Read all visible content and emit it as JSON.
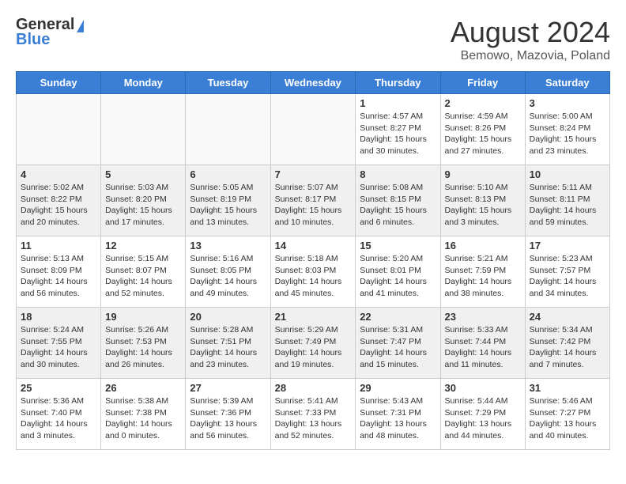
{
  "logo": {
    "text_general": "General",
    "text_blue": "Blue"
  },
  "title": "August 2024",
  "subtitle": "Bemowo, Mazovia, Poland",
  "weekdays": [
    "Sunday",
    "Monday",
    "Tuesday",
    "Wednesday",
    "Thursday",
    "Friday",
    "Saturday"
  ],
  "weeks": [
    [
      {
        "day": "",
        "info": ""
      },
      {
        "day": "",
        "info": ""
      },
      {
        "day": "",
        "info": ""
      },
      {
        "day": "",
        "info": ""
      },
      {
        "day": "1",
        "info": "Sunrise: 4:57 AM\nSunset: 8:27 PM\nDaylight: 15 hours\nand 30 minutes."
      },
      {
        "day": "2",
        "info": "Sunrise: 4:59 AM\nSunset: 8:26 PM\nDaylight: 15 hours\nand 27 minutes."
      },
      {
        "day": "3",
        "info": "Sunrise: 5:00 AM\nSunset: 8:24 PM\nDaylight: 15 hours\nand 23 minutes."
      }
    ],
    [
      {
        "day": "4",
        "info": "Sunrise: 5:02 AM\nSunset: 8:22 PM\nDaylight: 15 hours\nand 20 minutes."
      },
      {
        "day": "5",
        "info": "Sunrise: 5:03 AM\nSunset: 8:20 PM\nDaylight: 15 hours\nand 17 minutes."
      },
      {
        "day": "6",
        "info": "Sunrise: 5:05 AM\nSunset: 8:19 PM\nDaylight: 15 hours\nand 13 minutes."
      },
      {
        "day": "7",
        "info": "Sunrise: 5:07 AM\nSunset: 8:17 PM\nDaylight: 15 hours\nand 10 minutes."
      },
      {
        "day": "8",
        "info": "Sunrise: 5:08 AM\nSunset: 8:15 PM\nDaylight: 15 hours\nand 6 minutes."
      },
      {
        "day": "9",
        "info": "Sunrise: 5:10 AM\nSunset: 8:13 PM\nDaylight: 15 hours\nand 3 minutes."
      },
      {
        "day": "10",
        "info": "Sunrise: 5:11 AM\nSunset: 8:11 PM\nDaylight: 14 hours\nand 59 minutes."
      }
    ],
    [
      {
        "day": "11",
        "info": "Sunrise: 5:13 AM\nSunset: 8:09 PM\nDaylight: 14 hours\nand 56 minutes."
      },
      {
        "day": "12",
        "info": "Sunrise: 5:15 AM\nSunset: 8:07 PM\nDaylight: 14 hours\nand 52 minutes."
      },
      {
        "day": "13",
        "info": "Sunrise: 5:16 AM\nSunset: 8:05 PM\nDaylight: 14 hours\nand 49 minutes."
      },
      {
        "day": "14",
        "info": "Sunrise: 5:18 AM\nSunset: 8:03 PM\nDaylight: 14 hours\nand 45 minutes."
      },
      {
        "day": "15",
        "info": "Sunrise: 5:20 AM\nSunset: 8:01 PM\nDaylight: 14 hours\nand 41 minutes."
      },
      {
        "day": "16",
        "info": "Sunrise: 5:21 AM\nSunset: 7:59 PM\nDaylight: 14 hours\nand 38 minutes."
      },
      {
        "day": "17",
        "info": "Sunrise: 5:23 AM\nSunset: 7:57 PM\nDaylight: 14 hours\nand 34 minutes."
      }
    ],
    [
      {
        "day": "18",
        "info": "Sunrise: 5:24 AM\nSunset: 7:55 PM\nDaylight: 14 hours\nand 30 minutes."
      },
      {
        "day": "19",
        "info": "Sunrise: 5:26 AM\nSunset: 7:53 PM\nDaylight: 14 hours\nand 26 minutes."
      },
      {
        "day": "20",
        "info": "Sunrise: 5:28 AM\nSunset: 7:51 PM\nDaylight: 14 hours\nand 23 minutes."
      },
      {
        "day": "21",
        "info": "Sunrise: 5:29 AM\nSunset: 7:49 PM\nDaylight: 14 hours\nand 19 minutes."
      },
      {
        "day": "22",
        "info": "Sunrise: 5:31 AM\nSunset: 7:47 PM\nDaylight: 14 hours\nand 15 minutes."
      },
      {
        "day": "23",
        "info": "Sunrise: 5:33 AM\nSunset: 7:44 PM\nDaylight: 14 hours\nand 11 minutes."
      },
      {
        "day": "24",
        "info": "Sunrise: 5:34 AM\nSunset: 7:42 PM\nDaylight: 14 hours\nand 7 minutes."
      }
    ],
    [
      {
        "day": "25",
        "info": "Sunrise: 5:36 AM\nSunset: 7:40 PM\nDaylight: 14 hours\nand 3 minutes."
      },
      {
        "day": "26",
        "info": "Sunrise: 5:38 AM\nSunset: 7:38 PM\nDaylight: 14 hours\nand 0 minutes."
      },
      {
        "day": "27",
        "info": "Sunrise: 5:39 AM\nSunset: 7:36 PM\nDaylight: 13 hours\nand 56 minutes."
      },
      {
        "day": "28",
        "info": "Sunrise: 5:41 AM\nSunset: 7:33 PM\nDaylight: 13 hours\nand 52 minutes."
      },
      {
        "day": "29",
        "info": "Sunrise: 5:43 AM\nSunset: 7:31 PM\nDaylight: 13 hours\nand 48 minutes."
      },
      {
        "day": "30",
        "info": "Sunrise: 5:44 AM\nSunset: 7:29 PM\nDaylight: 13 hours\nand 44 minutes."
      },
      {
        "day": "31",
        "info": "Sunrise: 5:46 AM\nSunset: 7:27 PM\nDaylight: 13 hours\nand 40 minutes."
      }
    ]
  ]
}
